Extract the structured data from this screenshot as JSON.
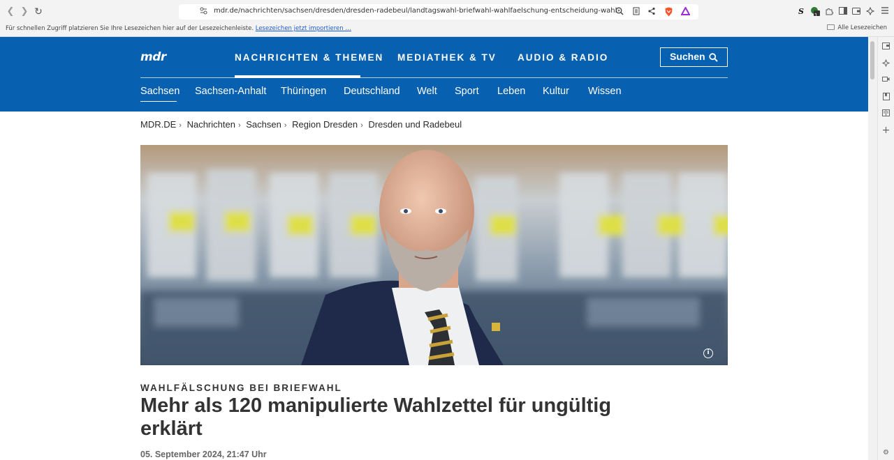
{
  "browser": {
    "url": "mdr.de/nachrichten/sachsen/dresden/dresden-radebeul/landtagswahl-briefwahl-wahlfaelschung-entscheidung-wahlzettel-freie-sachs…",
    "bookmarks_hint": "Für schnellen Zugriff platzieren Sie Ihre Lesezeichen hier auf der Lesezeichenleiste.",
    "bookmarks_import_link": "Lesezeichen jetzt importieren …",
    "all_bookmarks": "Alle Lesezeichen",
    "extension_badge": "1",
    "extension_letter": "S"
  },
  "site": {
    "logo": "mdr",
    "topnav": [
      {
        "label": "NACHRICHTEN & THEMEN",
        "active": true
      },
      {
        "label": "MEDIATHEK & TV",
        "active": false
      },
      {
        "label": "AUDIO & RADIO",
        "active": false
      }
    ],
    "search_label": "Suchen",
    "subnav": [
      "Sachsen",
      "Sachsen-Anhalt",
      "Thüringen",
      "Deutschland",
      "Welt",
      "Sport",
      "Leben",
      "Kultur",
      "Wissen"
    ]
  },
  "breadcrumb": [
    "MDR.DE",
    "Nachrichten",
    "Sachsen",
    "Region Dresden",
    "Dresden und Radebeul"
  ],
  "article": {
    "kicker": "WAHLFÄLSCHUNG BEI BRIEFWAHL",
    "headline": "Mehr als 120 manipulierte Wahlzettel für ungültig erklärt",
    "date": "05. September 2024, 21:47 Uhr"
  },
  "colors": {
    "brand": "#0760b0"
  }
}
